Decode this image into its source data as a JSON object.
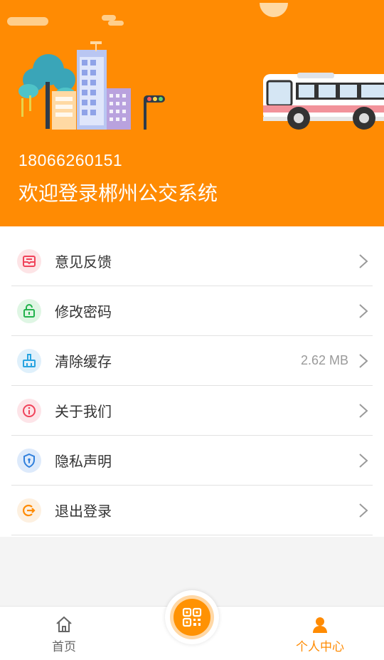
{
  "profile": {
    "phone": "18066260151",
    "welcome": "欢迎登录郴州公交系统"
  },
  "menu": {
    "items": [
      {
        "label": "意见反馈",
        "icon": "feedback-envelope-icon",
        "value": ""
      },
      {
        "label": "修改密码",
        "icon": "unlock-icon",
        "value": ""
      },
      {
        "label": "清除缓存",
        "icon": "broom-icon",
        "value": "2.62 MB"
      },
      {
        "label": "关于我们",
        "icon": "info-icon",
        "value": ""
      },
      {
        "label": "隐私声明",
        "icon": "shield-icon",
        "value": ""
      },
      {
        "label": "退出登录",
        "icon": "logout-icon",
        "value": ""
      }
    ]
  },
  "tabbar": {
    "home": "首页",
    "scan_icon": "qr-code-icon",
    "profile": "个人中心"
  },
  "colors": {
    "brand": "#ff8b03",
    "active_tab": "#ff8b03",
    "inactive_tab": "#666666"
  }
}
